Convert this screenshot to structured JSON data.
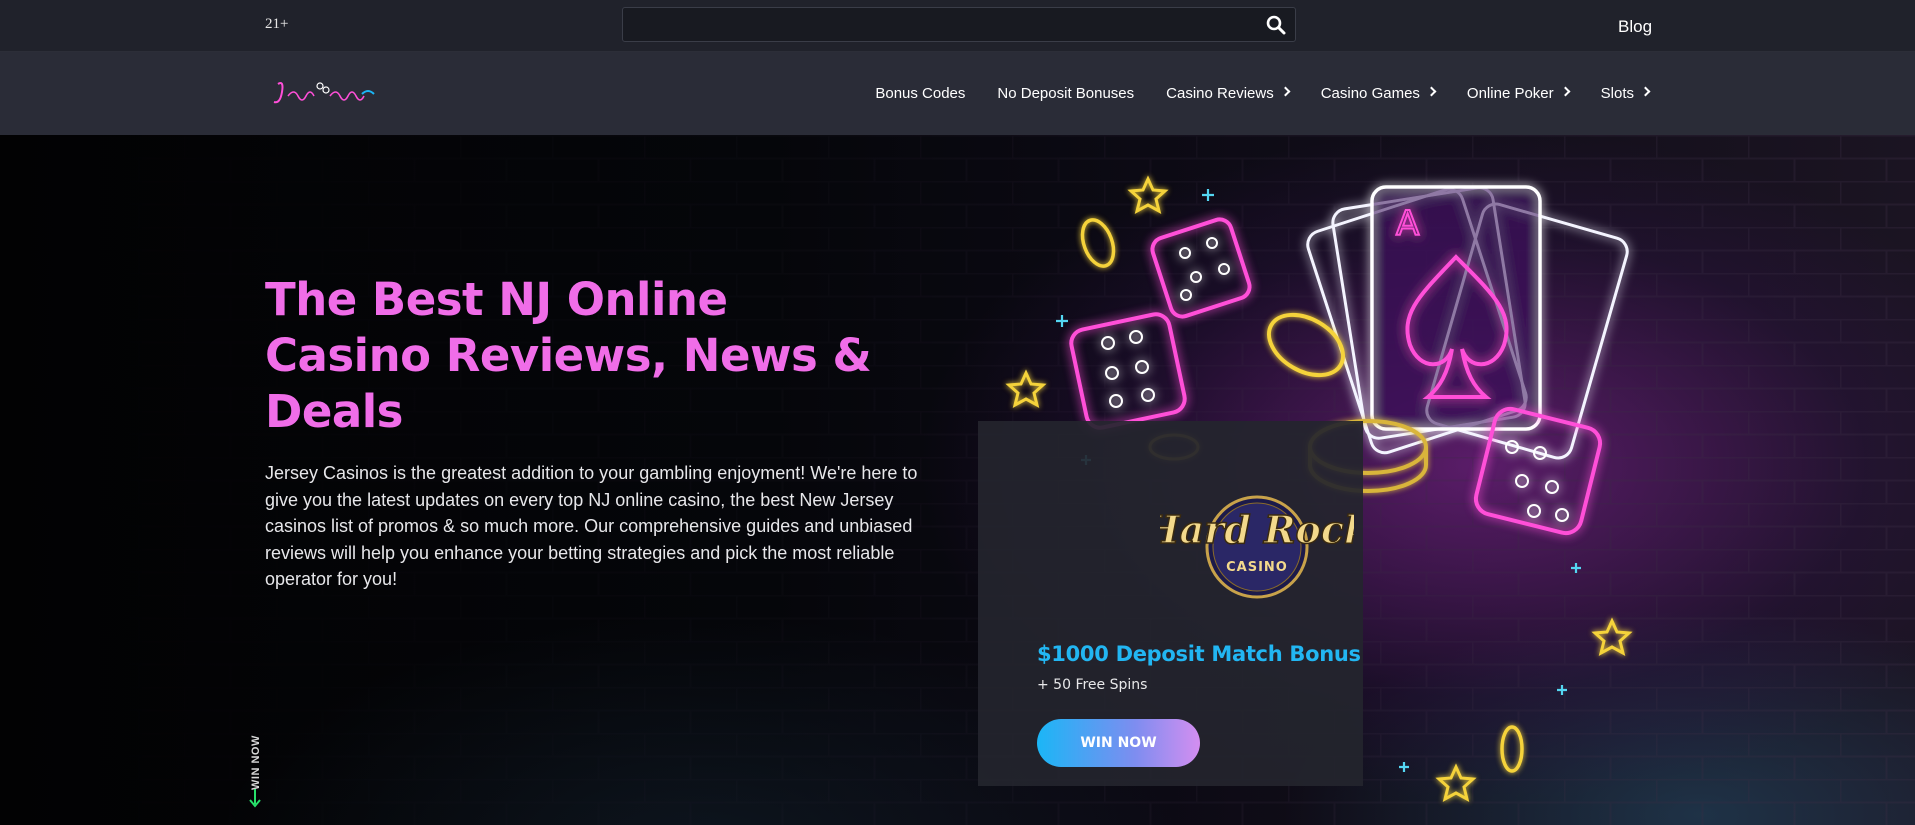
{
  "topbar": {
    "age_badge": "21+",
    "search": {
      "placeholder": "",
      "value": ""
    },
    "blog_label": "Blog"
  },
  "navbar": {
    "logo_text": "JerseyCasinos",
    "menu": [
      {
        "label": "Bonus Codes",
        "has_submenu": false
      },
      {
        "label": "No Deposit Bonuses",
        "has_submenu": false
      },
      {
        "label": "Casino Reviews",
        "has_submenu": true
      },
      {
        "label": "Casino Games",
        "has_submenu": true
      },
      {
        "label": "Online Poker",
        "has_submenu": true
      },
      {
        "label": "Slots",
        "has_submenu": true
      }
    ]
  },
  "hero": {
    "headline": "The Best NJ Online Casino Reviews, News & Deals",
    "intro": "Jersey Casinos is the greatest addition to your gambling enjoyment! We're here to give you the latest updates on every top NJ online casino, the best New Jersey casinos list of promos & so much more. Our comprehensive guides and unbiased reviews will help you enhance your betting strategies and pick the most reliable operator for you!",
    "side_label": "WIN NOW",
    "illustration_icons": [
      "neon-playing-cards-icon",
      "neon-dice-icon",
      "neon-coin-icon",
      "neon-star-icon"
    ]
  },
  "offer_card": {
    "brand_logo_text": "Hard Rock",
    "brand_logo_subtext": "CASINO",
    "bonus_title": "$1000 Deposit Match Bonus",
    "bonus_subtitle": "+ 50 Free Spins",
    "cta_label": "WIN NOW"
  },
  "colors": {
    "topbar_bg": "#20222b",
    "navbar_bg": "#2a2c37",
    "headline_pink": "#f06de8",
    "bonus_blue": "#22b6f2",
    "neon_pink": "#ff4fd8",
    "neon_yellow": "#f5d33a",
    "arrow_green": "#27e06a"
  }
}
